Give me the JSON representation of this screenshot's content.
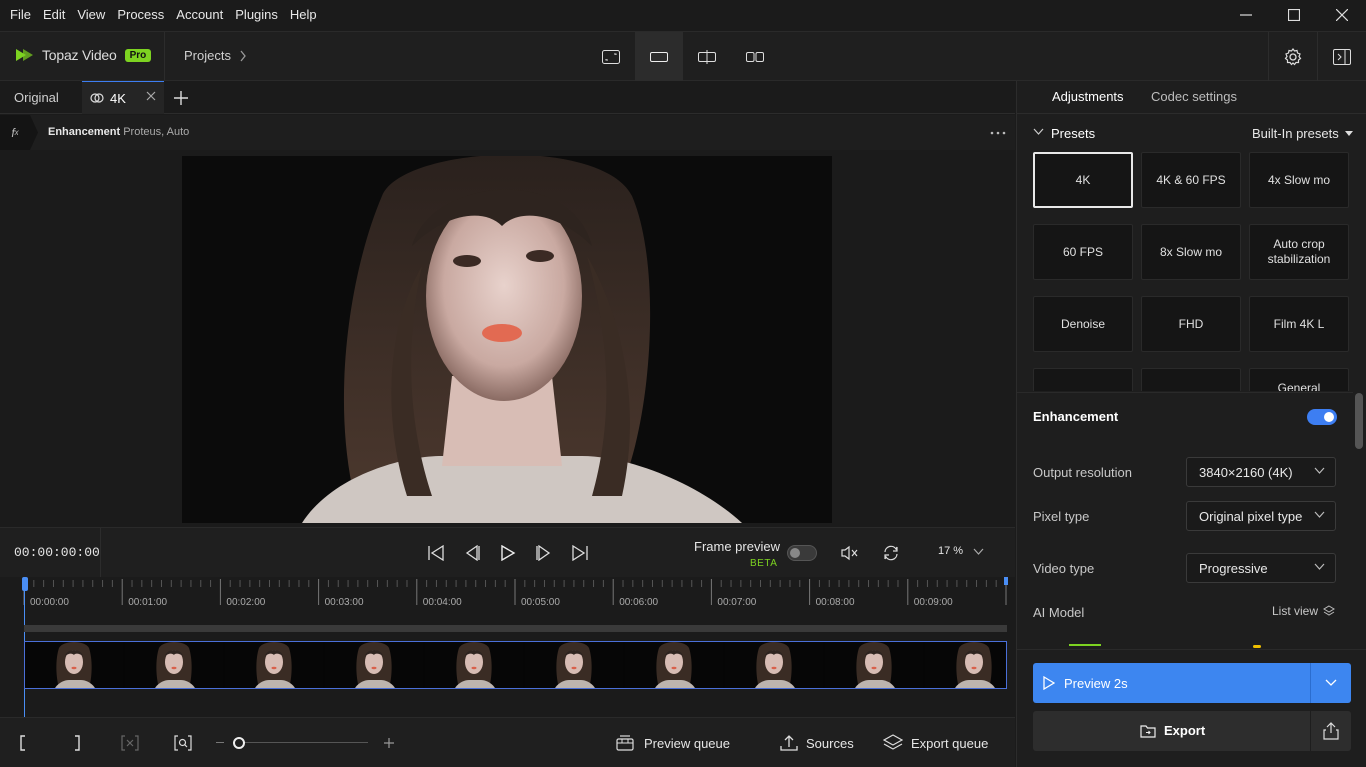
{
  "menu": [
    "File",
    "Edit",
    "View",
    "Process",
    "Account",
    "Plugins",
    "Help"
  ],
  "brand": {
    "name": "Topaz Video",
    "badge": "Pro",
    "accent": "#7dd321"
  },
  "breadcrumb": {
    "projects": "Projects"
  },
  "tabs": {
    "original": "Original",
    "current": "4K"
  },
  "enhancement_bar": {
    "title": "Enhancement",
    "detail": "Proteus, Auto"
  },
  "transport": {
    "timecode": "00:00:00:00",
    "frame_preview": "Frame preview",
    "beta": "BETA",
    "zoom": "17 %"
  },
  "timeline": {
    "ticks": [
      "00:00:00",
      "00:01:00",
      "00:02:00",
      "00:03:00",
      "00:04:00",
      "00:05:00",
      "00:06:00",
      "00:07:00",
      "00:08:00",
      "00:09:00"
    ]
  },
  "bottom": {
    "preview_queue": "Preview queue",
    "sources": "Sources",
    "export_queue": "Export queue"
  },
  "right_panel": {
    "tabs": [
      "Adjustments",
      "Codec settings"
    ],
    "presets_title": "Presets",
    "presets_source": "Built-In presets",
    "presets": [
      "4K",
      "4K & 60 FPS",
      "4x Slow mo",
      "60 FPS",
      "8x Slow mo",
      "Auto crop stabilization",
      "Denoise",
      "FHD",
      "Film 4K L",
      "",
      "",
      "General"
    ],
    "enhancement_title": "Enhancement",
    "output_resolution": {
      "label": "Output resolution",
      "value": "3840×2160 (4K)"
    },
    "pixel_type": {
      "label": "Pixel type",
      "value": "Original pixel type"
    },
    "video_type": {
      "label": "Video type",
      "value": "Progressive"
    },
    "ai_model": {
      "label": "AI Model",
      "view": "List view"
    },
    "preview_button": "Preview 2s",
    "export_button": "Export",
    "accent": "#3d86f0"
  }
}
